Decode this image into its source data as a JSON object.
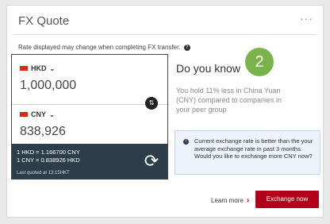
{
  "card": {
    "title": "FX Quote",
    "more_label": "···",
    "disclaimer": "Rate displayed may change when completing FX transfer.",
    "help_icon": "?"
  },
  "converter": {
    "from_currency": "HKD",
    "from_amount": "1,000,000",
    "to_currency": "CNY",
    "to_amount": "838,926",
    "swap_icon": "⇅",
    "rate_line_1": "1 HKD = 1.166700 CNY",
    "rate_line_2": "1 CNY = 0.838926 HKD",
    "last_quoted": "Last quoted at 13:15HKT",
    "refresh_icon": "⟳",
    "chevron": "⌄"
  },
  "insight": {
    "title": "Do you know",
    "badge_number": "2",
    "text": "You hold 11% less in China Yuan (CNY) compared to companies in your peer group",
    "info_icon": "i",
    "info_text": "Current exchange rate is better than the your average exchange rate in past 3 months. Would you like to exchange more CNY now?"
  },
  "actions": {
    "learn_more": "Learn more",
    "learn_more_chevron": "›",
    "exchange_now": "Exchange now"
  },
  "colors": {
    "brand_red": "#b3001b",
    "badge_green": "#7bb34b",
    "rates_panel": "#2c3e4a"
  }
}
